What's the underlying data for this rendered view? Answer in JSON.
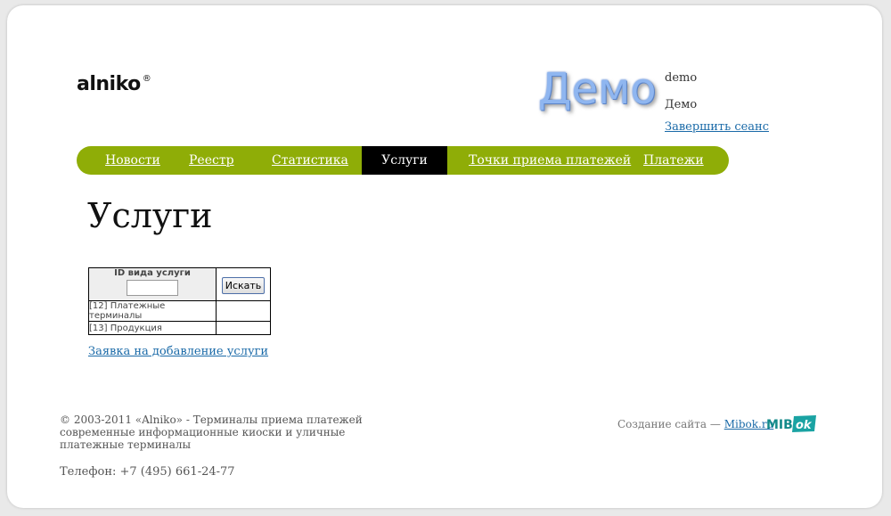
{
  "header": {
    "logo_text": "alniko",
    "logo_mark": "®",
    "demo_banner": "Демо",
    "user_login": "demo",
    "user_name": "Демо",
    "logout_label": "Завершить сеанс"
  },
  "nav": {
    "items": [
      {
        "label": "Новости",
        "active": false
      },
      {
        "label": "Реестр",
        "active": false
      },
      {
        "label": "Статистика",
        "active": false
      },
      {
        "label": "Услуги",
        "active": true
      },
      {
        "label": "Точки приема платежей",
        "active": false
      },
      {
        "label": "Платежи",
        "active": false
      }
    ]
  },
  "main": {
    "title": "Услуги",
    "filter": {
      "column_header": "ID вида услуги",
      "input_value": "",
      "search_label": "Искать"
    },
    "rows": [
      {
        "label": "[12] Платежные терминалы"
      },
      {
        "label": "[13] Продукция"
      }
    ],
    "add_link": "Заявка на добавление услуги"
  },
  "footer": {
    "copyright": "© 2003-2011 «Alniko» - Терминалы приема платежей современные информационные киоски и уличные платежные терминалы",
    "phone": "Телефон: +7 (495) 661-24-77",
    "credit_prefix": "Создание сайта —",
    "credit_link": "Mibok.ru",
    "mibok_logo": "MIBok"
  },
  "colors": {
    "nav_bg": "#8fad07",
    "nav_active_bg": "#000000",
    "link": "#1a6aa8",
    "demo_banner": "#8fb6f0"
  }
}
